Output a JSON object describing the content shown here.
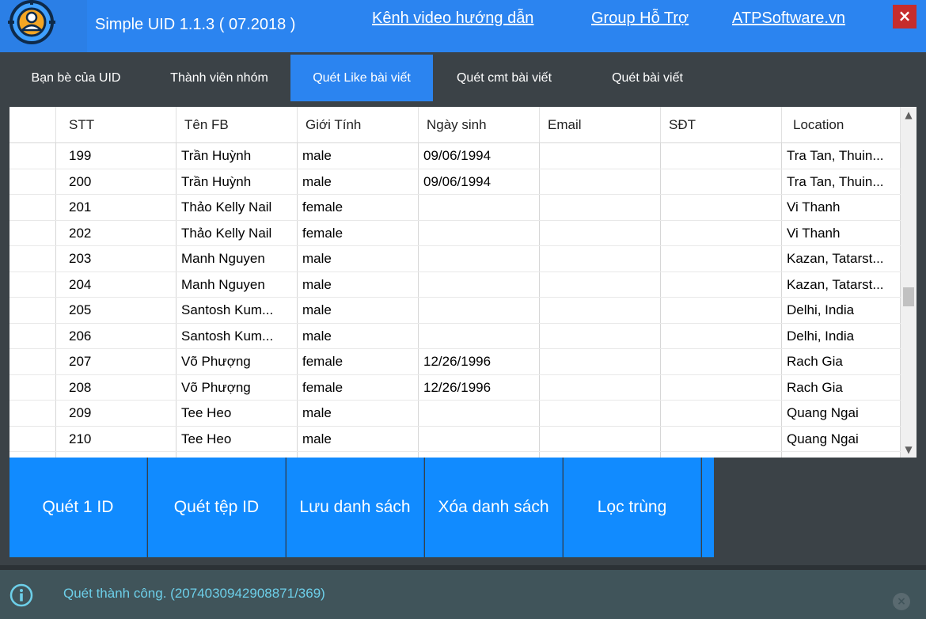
{
  "header": {
    "app_title": "Simple UID 1.1.3 ( 07.2018 )",
    "links": [
      "Kênh video hướng dẫn",
      "Group Hỗ Trợ",
      "ATPSoftware.vn"
    ],
    "close_label": "×"
  },
  "tabs": [
    {
      "label": "Bạn bè của UID",
      "active": false
    },
    {
      "label": "Thành viên nhóm",
      "active": false
    },
    {
      "label": "Quét Like bài viết",
      "active": true
    },
    {
      "label": "Quét cmt bài viết",
      "active": false
    },
    {
      "label": "Quét bài viết",
      "active": false
    }
  ],
  "table": {
    "columns": [
      "",
      "STT",
      "Tên FB",
      "Giới Tính",
      "Ngày sinh",
      "Email",
      "SĐT",
      "Location"
    ],
    "rows": [
      [
        "",
        "199",
        "Trần Huỳnh",
        "male",
        "09/06/1994",
        "",
        "",
        "Tra Tan, Thuin..."
      ],
      [
        "",
        "200",
        "Trần Huỳnh",
        "male",
        "09/06/1994",
        "",
        "",
        "Tra Tan, Thuin..."
      ],
      [
        "",
        "201",
        "Thảo Kelly Nail",
        "female",
        "",
        "",
        "",
        "Vi Thanh"
      ],
      [
        "",
        "202",
        "Thảo Kelly Nail",
        "female",
        "",
        "",
        "",
        "Vi Thanh"
      ],
      [
        "",
        "203",
        "Manh Nguyen",
        "male",
        "",
        "",
        "",
        "Kazan, Tatarst..."
      ],
      [
        "",
        "204",
        "Manh Nguyen",
        "male",
        "",
        "",
        "",
        "Kazan, Tatarst..."
      ],
      [
        "",
        "205",
        "Santosh Kum...",
        "male",
        "",
        "",
        "",
        "Delhi, India"
      ],
      [
        "",
        "206",
        "Santosh Kum...",
        "male",
        "",
        "",
        "",
        "Delhi, India"
      ],
      [
        "",
        "207",
        "Võ Phượng",
        "female",
        "12/26/1996",
        "",
        "",
        "Rach Gia"
      ],
      [
        "",
        "208",
        "Võ Phượng",
        "female",
        "12/26/1996",
        "",
        "",
        "Rach Gia"
      ],
      [
        "",
        "209",
        "Tee Heo",
        "male",
        "",
        "",
        "",
        "Quang Ngai"
      ],
      [
        "",
        "210",
        "Tee Heo",
        "male",
        "",
        "",
        "",
        "Quang Ngai"
      ],
      [
        "",
        "",
        "",
        "",
        "",
        "",
        "",
        ""
      ]
    ],
    "scroll_up_icon": "▲",
    "scroll_down_icon": "▼"
  },
  "actions": [
    "Quét 1 ID",
    "Quét tệp ID",
    "Lưu danh sách",
    "Xóa danh sách",
    "Lọc trùng"
  ],
  "status": {
    "message": "Quét thành công. (2074030942908871/369)",
    "close_label": "×"
  },
  "colors": {
    "accent": "#2b84f0",
    "button": "#118bff",
    "background": "#3b4247",
    "status_bg": "#40545a",
    "status_text": "#6dcfe9"
  }
}
